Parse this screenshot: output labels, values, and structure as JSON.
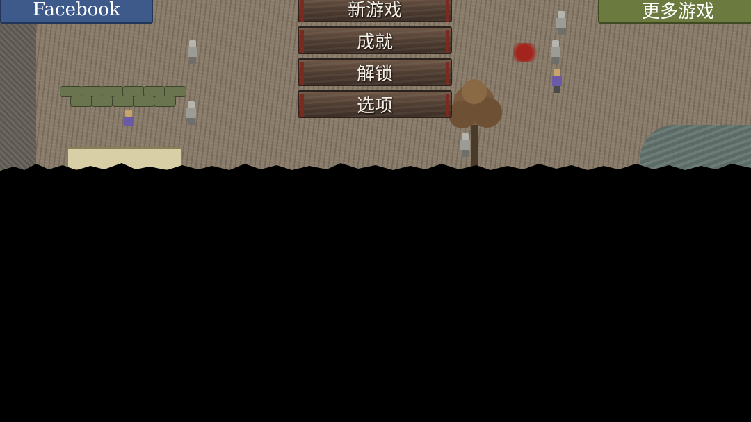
{
  "header": {
    "facebook_label": "Facebook",
    "more_games_label": "更多游戏"
  },
  "menu": {
    "items": [
      {
        "id": "new-game",
        "label": "新游戏"
      },
      {
        "id": "achievements",
        "label": "成就"
      },
      {
        "id": "unlock",
        "label": "解锁"
      },
      {
        "id": "options",
        "label": "选项"
      }
    ]
  },
  "colors": {
    "facebook_blue": "#3d5a8a",
    "more_games_green": "#6b7a3e",
    "plank_brown": "#4e3c31",
    "ground": "#8a7c6a"
  }
}
